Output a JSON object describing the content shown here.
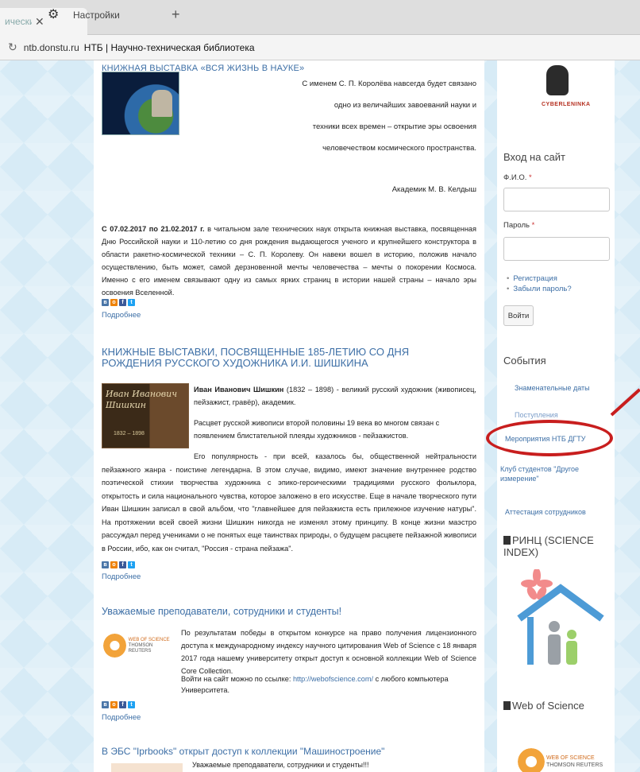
{
  "browser": {
    "tab_title": "ически",
    "tab_close": "✕",
    "settings_tab_label": "Настройки",
    "new_tab": "+",
    "reload_glyph": "↻",
    "url": "ntb.donstu.ru",
    "page_title": "НТБ | Научно-техническая библиотека"
  },
  "main": {
    "sec1": {
      "title": "КНИЖНАЯ ВЫСТАВКА «ВСЯ ЖИЗНЬ В НАУКЕ»",
      "quote_lines": [
        "С именем С. П. Королёва навсегда будет связано",
        "одно из величайших завоеваний науки и",
        "техники всех времен – открытие эры освоения",
        "человечеством космического пространства."
      ],
      "author": "Академик М. В. Келдыш",
      "date_lead": "С 07.02.2017 по 21.02.2017 г.",
      "paragraph": " в читальном зале технических наук открыта книжная выставка, посвященная Дню Российской науки и 110-летию со дня рождения выдающегося ученого и крупнейшего конструктора в области ракетно-космической техники – С. П. Королеву. Он навеки вошел в историю, положив начало осуществлению, быть может, самой дерзновенной мечты человечества – мечты о покорении Космоса. Именно с его именем связывают одну из самых ярких страниц в истории нашей страны – начало эры освоения Вселенной.",
      "more": "Подробнее"
    },
    "sec2": {
      "title": "КНИЖНЫЕ ВЫСТАВКИ, ПОСВЯЩЕННЫЕ 185-ЛЕТИЮ СО ДНЯ РОЖДЕНИЯ РУССКОГО ХУДОЖНИКА И.И. ШИШКИНА",
      "image_signature": "Иван Иванович Шишкин",
      "image_years": "1832 – 1898",
      "name_bold": "Иван Иванович Шишкин",
      "intro": " (1832 – 1898) - великий русский художник (живописец, пейзажист, гравёр), академик.",
      "p2": "Расцвет русской живописи второй половины 19 века во многом связан с появлением блистательной плеяды художников - пейзажистов.",
      "p3": "Его популярность - при всей, казалось бы, общественной нейтральности пейзажного жанра - поистине легендарна. В этом случае, видимо, имеют значение внутреннее родство поэтической стихии творчества художника с эпико-героическими традициями русского фольклора, открытость и сила национального чувства, которое заложено в его искусстве. Еще в начале творческого пути Иван Шишкин записал в свой альбом, что \"главнейшее для пейзажиста есть прилежное изучение натуры\". На протяжении всей своей жизни Шишкин никогда не изменял этому принципу. В конце жизни маэстро рассуждал перед учениками о не понятых еще таинствах природы, о будущем расцвете пейзажной живописи в России, ибо, как он считал, \"Россия - страна пейзажа\".",
      "more": "Подробнее"
    },
    "sec3": {
      "title": "Уважаемые преподаватели, сотрудники и студенты!",
      "logo_line1": "WEB OF SCIENCE",
      "logo_line2": "THOMSON REUTERS",
      "paragraph": "По результатам победы в открытом конкурсе на право получения лицензионного доступа к международному индексу научного цитирования Web of Science с 18 января 2017 года нашему университету открыт доступ к основной коллекции Web of Science Core Collection.",
      "link_lead": "Войти на сайт можно по ссылке: ",
      "link": "http://webofscience.com/",
      "link_tail": " с любого компьютера Университета.",
      "more": "Подробнее"
    },
    "sec4": {
      "title": "В ЭБС \"Iprbooks\" открыт доступ к коллекции \"Машиностроение\"",
      "text": "Уважаемые преподаватели, сотрудники и студенты!!!"
    }
  },
  "sidebar": {
    "logo_text": "CYBERLENINKA",
    "login_heading": "Вход на сайт",
    "fio_label": "Ф.И.О.",
    "password_label": "Пароль",
    "required_mark": "*",
    "links": [
      "Регистрация",
      "Забыли пароль?"
    ],
    "login_button": "Войти",
    "events_heading": "События",
    "events": [
      "Знаменательные даты",
      "Поступления",
      "Мероприятия НТБ ДГТУ",
      "Клуб студентов \"Другое измерение\"",
      "Аттестация сотрудников"
    ],
    "rinc_heading": "РИНЦ (SCIENCE INDEX)",
    "wos_heading": "Web of Science",
    "wos_logo_line1": "WEB OF SCIENCE",
    "wos_logo_line2": "THOMSON REUTERS"
  },
  "colors": {
    "link": "#3d6fa6",
    "annotation": "#c81e1e",
    "background": "#d7ebf6"
  }
}
